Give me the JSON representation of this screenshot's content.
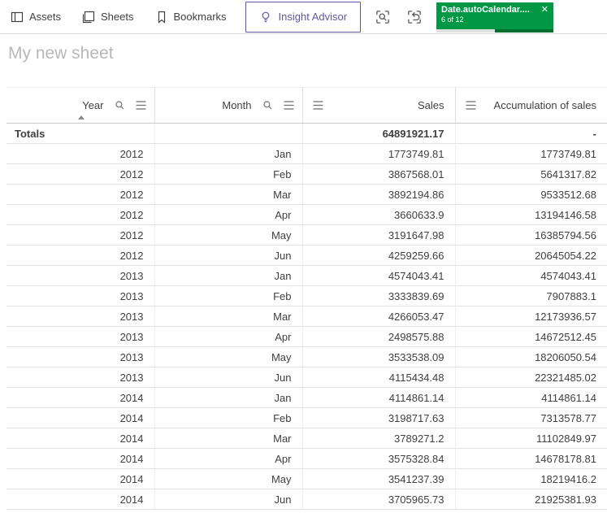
{
  "toolbar": {
    "tabs": [
      {
        "label": "Assets",
        "icon": "assets-panel-icon"
      },
      {
        "label": "Sheets",
        "icon": "sheets-icon"
      },
      {
        "label": "Bookmarks",
        "icon": "bookmark-icon"
      }
    ],
    "insight_advisor": {
      "label": "Insight Advisor",
      "icon": "lightbulb-icon",
      "accent_color": "#5c58a6"
    },
    "icon_buttons": [
      {
        "name": "smart-search",
        "icon": "viewfinder-search-icon",
        "enabled": true
      },
      {
        "name": "selections-step-back",
        "icon": "viewfinder-undo-icon",
        "enabled": true
      },
      {
        "name": "selections-step-forward",
        "icon": "viewfinder-redo-icon",
        "enabled": false
      },
      {
        "name": "clear-all-selections",
        "icon": "viewfinder-clear-icon",
        "enabled": true
      }
    ],
    "selection_badge": {
      "field": "Date.autoCalendar....",
      "selected": "6 of 12",
      "green": "#009845",
      "bar_selected_fraction": 0.5,
      "close_icon": "✕"
    }
  },
  "sheet": {
    "title": "My new sheet"
  },
  "table": {
    "columns": [
      {
        "label": "Year",
        "type": "dimension",
        "icons": [
          "search-icon",
          "menu-icon"
        ],
        "sort": "asc"
      },
      {
        "label": "Month",
        "type": "dimension",
        "icons": [
          "search-icon",
          "menu-icon"
        ]
      },
      {
        "label": "Sales",
        "type": "measure",
        "icons": [
          "menu-icon"
        ]
      },
      {
        "label": "Accumulation of sales",
        "type": "measure",
        "icons": [
          "menu-icon"
        ]
      }
    ],
    "totals": {
      "label": "Totals",
      "month": "",
      "sales": "64891921.17",
      "accumulation": "-"
    },
    "rows": [
      [
        "2012",
        "Jan",
        "1773749.81",
        "1773749.81"
      ],
      [
        "2012",
        "Feb",
        "3867568.01",
        "5641317.82"
      ],
      [
        "2012",
        "Mar",
        "3892194.86",
        "9533512.68"
      ],
      [
        "2012",
        "Apr",
        "3660633.9",
        "13194146.58"
      ],
      [
        "2012",
        "May",
        "3191647.98",
        "16385794.56"
      ],
      [
        "2012",
        "Jun",
        "4259259.66",
        "20645054.22"
      ],
      [
        "2013",
        "Jan",
        "4574043.41",
        "4574043.41"
      ],
      [
        "2013",
        "Feb",
        "3333839.69",
        "7907883.1"
      ],
      [
        "2013",
        "Mar",
        "4266053.47",
        "12173936.57"
      ],
      [
        "2013",
        "Apr",
        "2498575.88",
        "14672512.45"
      ],
      [
        "2013",
        "May",
        "3533538.09",
        "18206050.54"
      ],
      [
        "2013",
        "Jun",
        "4115434.48",
        "22321485.02"
      ],
      [
        "2014",
        "Jan",
        "4114861.14",
        "4114861.14"
      ],
      [
        "2014",
        "Feb",
        "3198717.63",
        "7313578.77"
      ],
      [
        "2014",
        "Mar",
        "3789271.2",
        "11102849.97"
      ],
      [
        "2014",
        "Apr",
        "3575328.84",
        "14678178.81"
      ],
      [
        "2014",
        "May",
        "3541237.39",
        "18219416.2"
      ],
      [
        "2014",
        "Jun",
        "3705965.73",
        "21925381.93"
      ]
    ]
  }
}
